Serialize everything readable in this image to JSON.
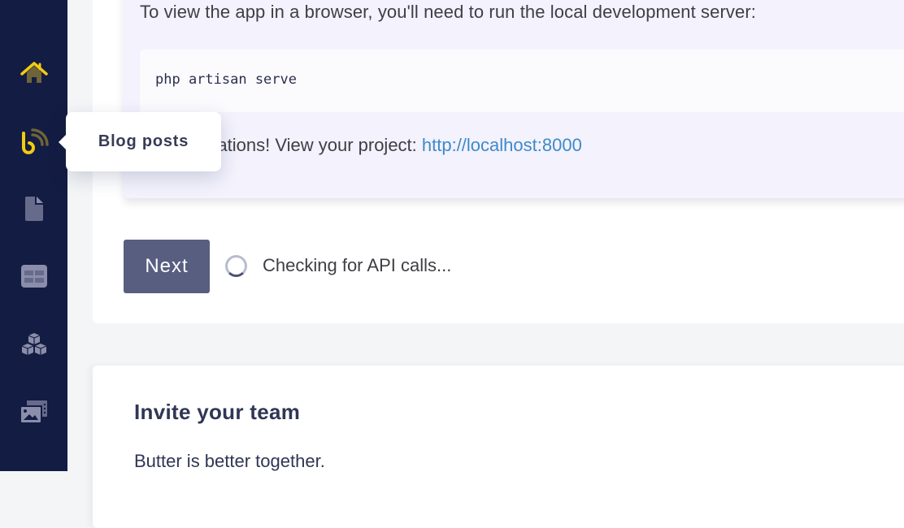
{
  "sidebar": {
    "items": [
      {
        "name": "home",
        "icon": "home-icon",
        "active": true
      },
      {
        "name": "blog-posts",
        "icon": "blog-icon",
        "label": "Blog posts",
        "active": true
      },
      {
        "name": "pages",
        "icon": "page-icon"
      },
      {
        "name": "collections",
        "icon": "table-icon"
      },
      {
        "name": "components",
        "icon": "blocks-icon"
      },
      {
        "name": "media",
        "icon": "media-library-icon"
      }
    ],
    "colors": {
      "background": "#131c42",
      "active": "#f2cb12",
      "inactive": "#7a7f9a"
    }
  },
  "tooltip": {
    "label": "Blog posts"
  },
  "setup": {
    "instruction": "To view the app in a browser, you'll need to run the local development server:",
    "command": "php artisan serve",
    "congrats_prefix": "Congratulations! View your project: ",
    "project_link": "http://localhost:8000",
    "next_button": "Next",
    "status": "Checking for API calls..."
  },
  "invite": {
    "title": "Invite your team",
    "subtitle": "Butter is better together."
  }
}
